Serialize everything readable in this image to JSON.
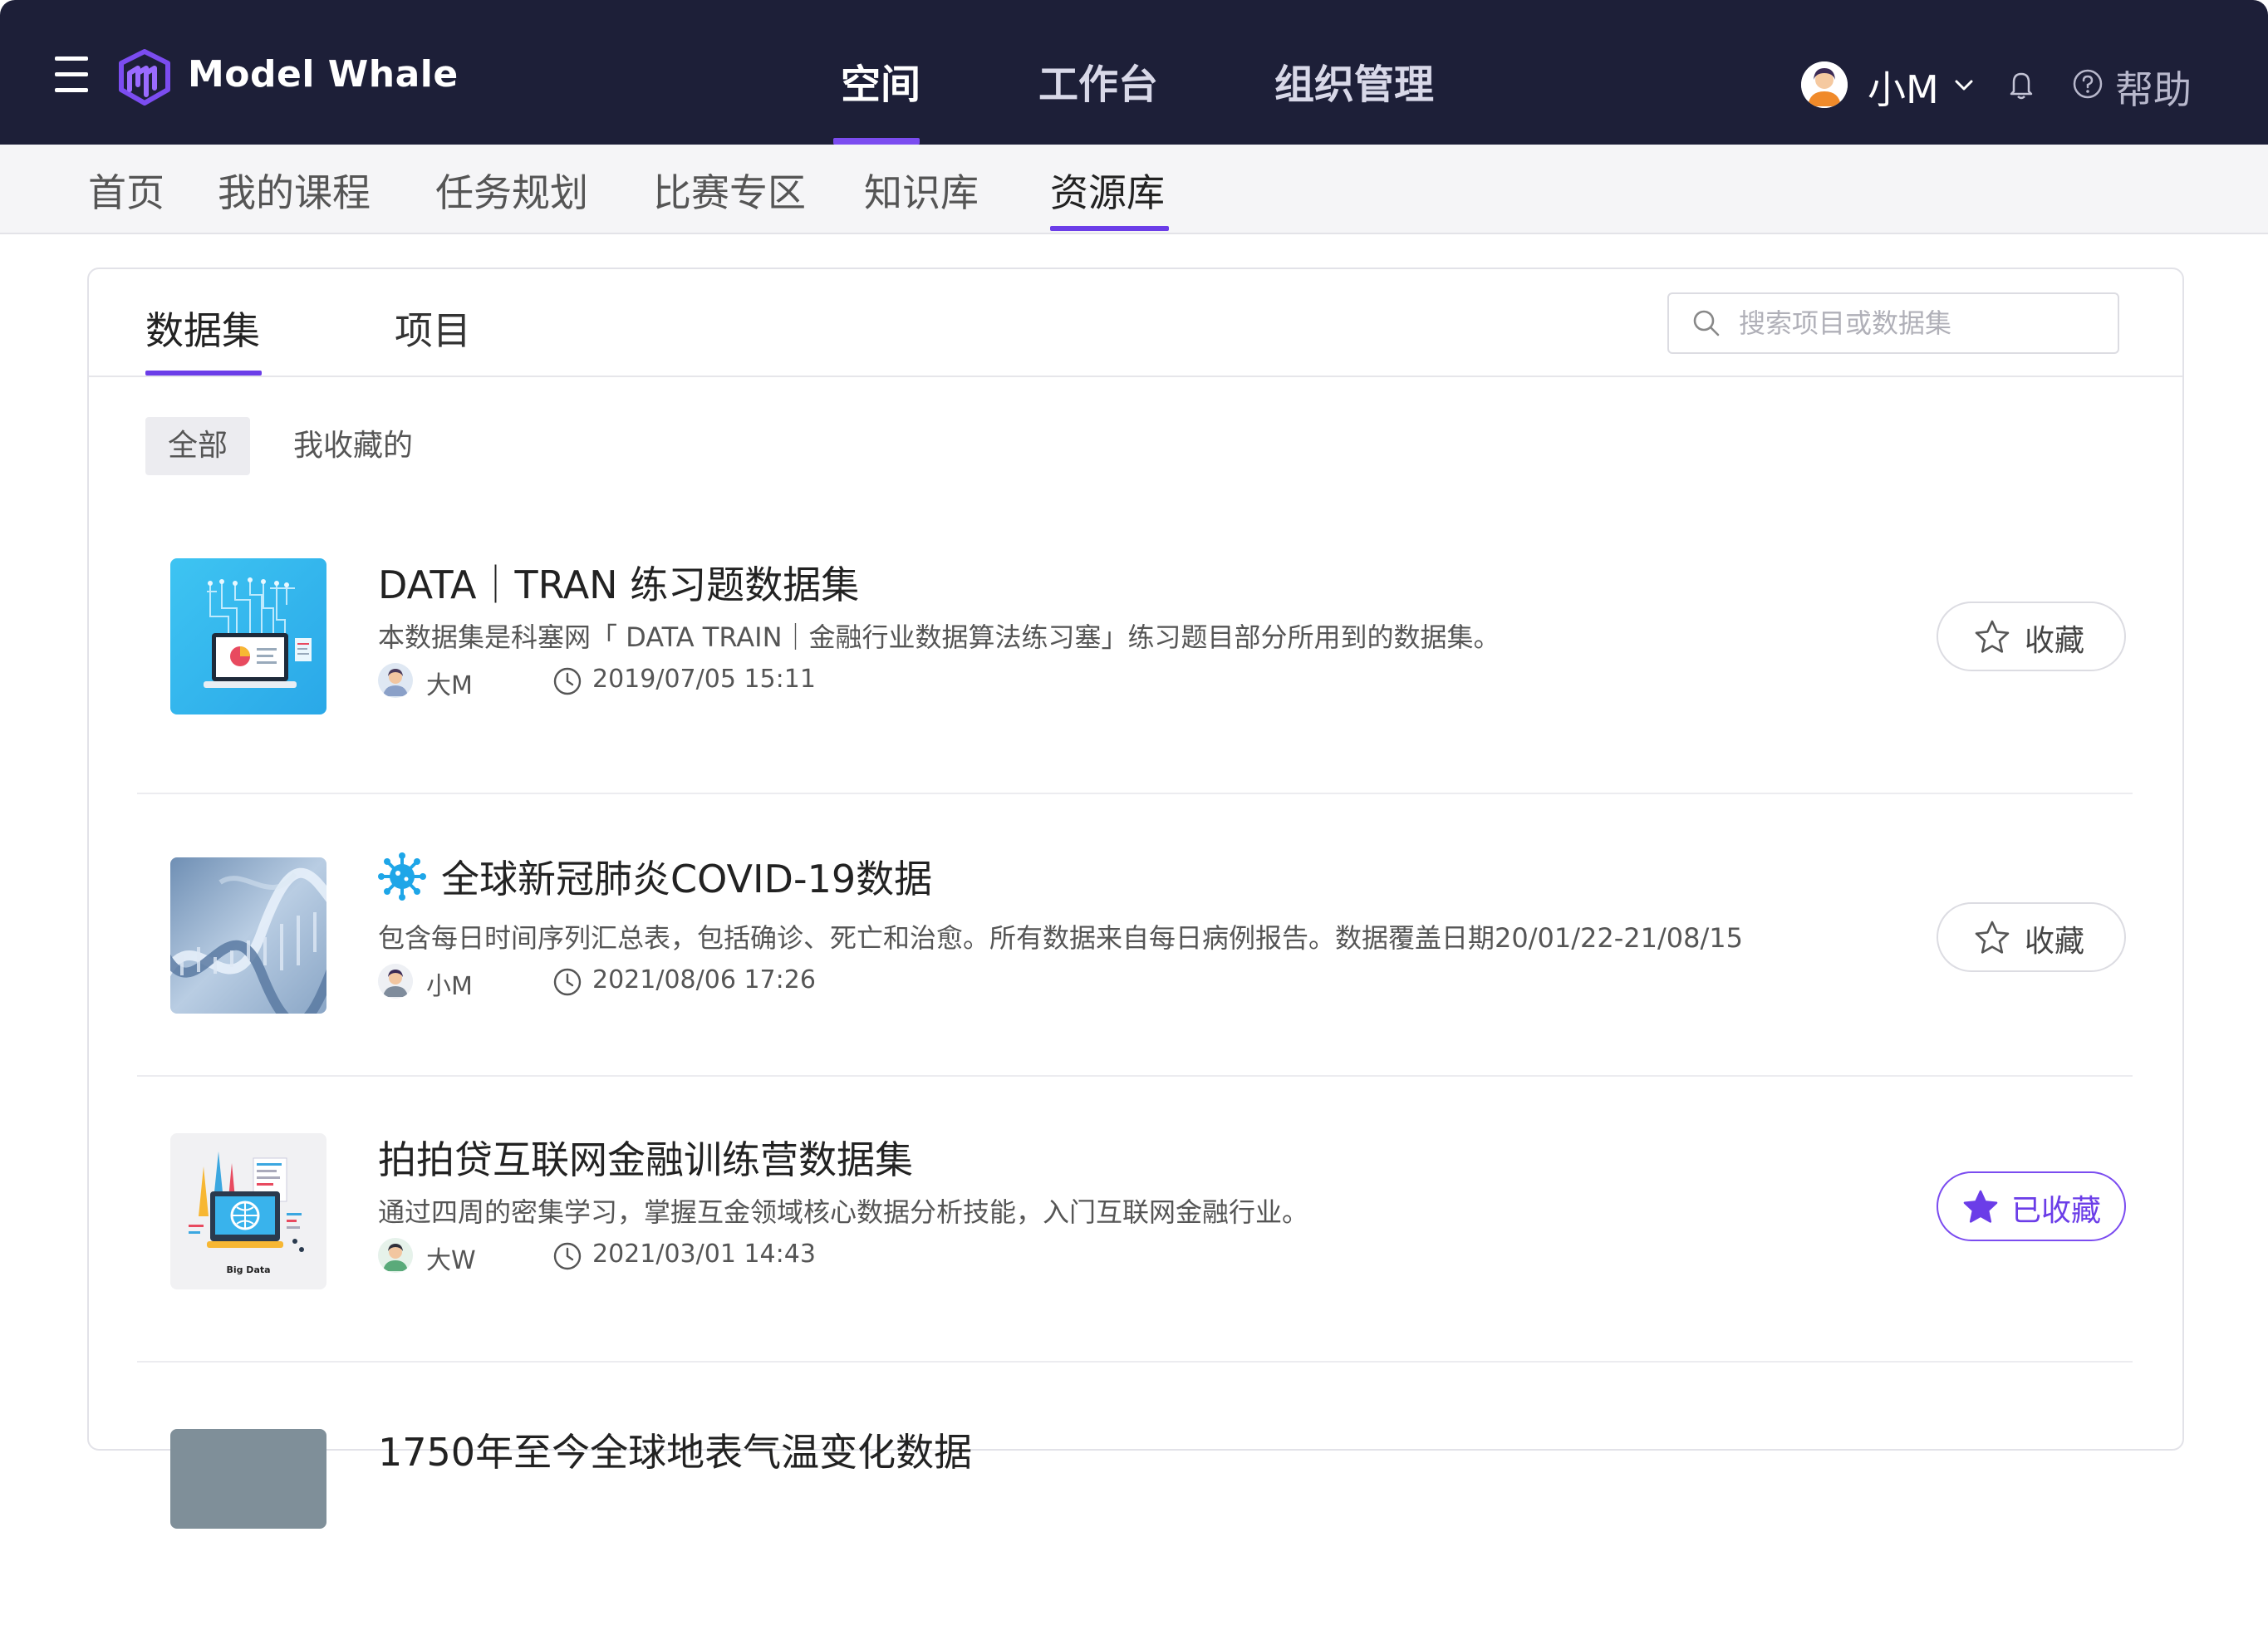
{
  "app": {
    "name": "Model Whale",
    "accent": "#6b3de8",
    "topbar_bg": "#1d1f38"
  },
  "main_nav": [
    {
      "label": "空间",
      "active": true
    },
    {
      "label": "工作台",
      "active": false
    },
    {
      "label": "组织管理",
      "active": false
    }
  ],
  "user": {
    "name": "小M",
    "help": "帮助"
  },
  "sub_nav": [
    {
      "label": "首页"
    },
    {
      "label": "我的课程"
    },
    {
      "label": "任务规划"
    },
    {
      "label": "比赛专区"
    },
    {
      "label": "知识库"
    },
    {
      "label": "资源库",
      "active": true
    }
  ],
  "panel": {
    "tabs": [
      {
        "label": "数据集",
        "active": true
      },
      {
        "label": "项目",
        "active": false
      }
    ],
    "search_placeholder": "搜索项目或数据集",
    "filters": {
      "all": "全部",
      "favorites": "我收藏的"
    }
  },
  "datasets": [
    {
      "title": "DATA｜TRAN 练习题数据集",
      "description": "本数据集是科塞网「 DATA TRAIN｜金融行业数据算法练习塞」练习题目部分所用到的数据集。",
      "author": "大M",
      "time": "2019/07/05 15:11",
      "favorite_label": "收藏",
      "favorited": false,
      "thumb": "circuit-laptop"
    },
    {
      "title": "全球新冠肺炎COVID-19数据",
      "description": "包含每日时间序列汇总表，包括确诊、死亡和治愈。所有数据来自每日病例报告。数据覆盖日期20/01/22-21/08/15",
      "author": "小M",
      "time": "2021/08/06 17:26",
      "favorite_label": "收藏",
      "favorited": false,
      "thumb": "dna-helix",
      "title_icon": "virus-icon"
    },
    {
      "title": "拍拍贷互联网金融训练营数据集",
      "description": "通过四周的密集学习，掌握互金领域核心数据分析技能，入门互联网金融行业。",
      "author": "大W",
      "time": "2021/03/01 14:43",
      "favorite_label": "已收藏",
      "favorited": true,
      "thumb": "big-data",
      "thumb_caption": "Big Data"
    },
    {
      "title": "1750年至今全球地表气温变化数据"
    }
  ]
}
